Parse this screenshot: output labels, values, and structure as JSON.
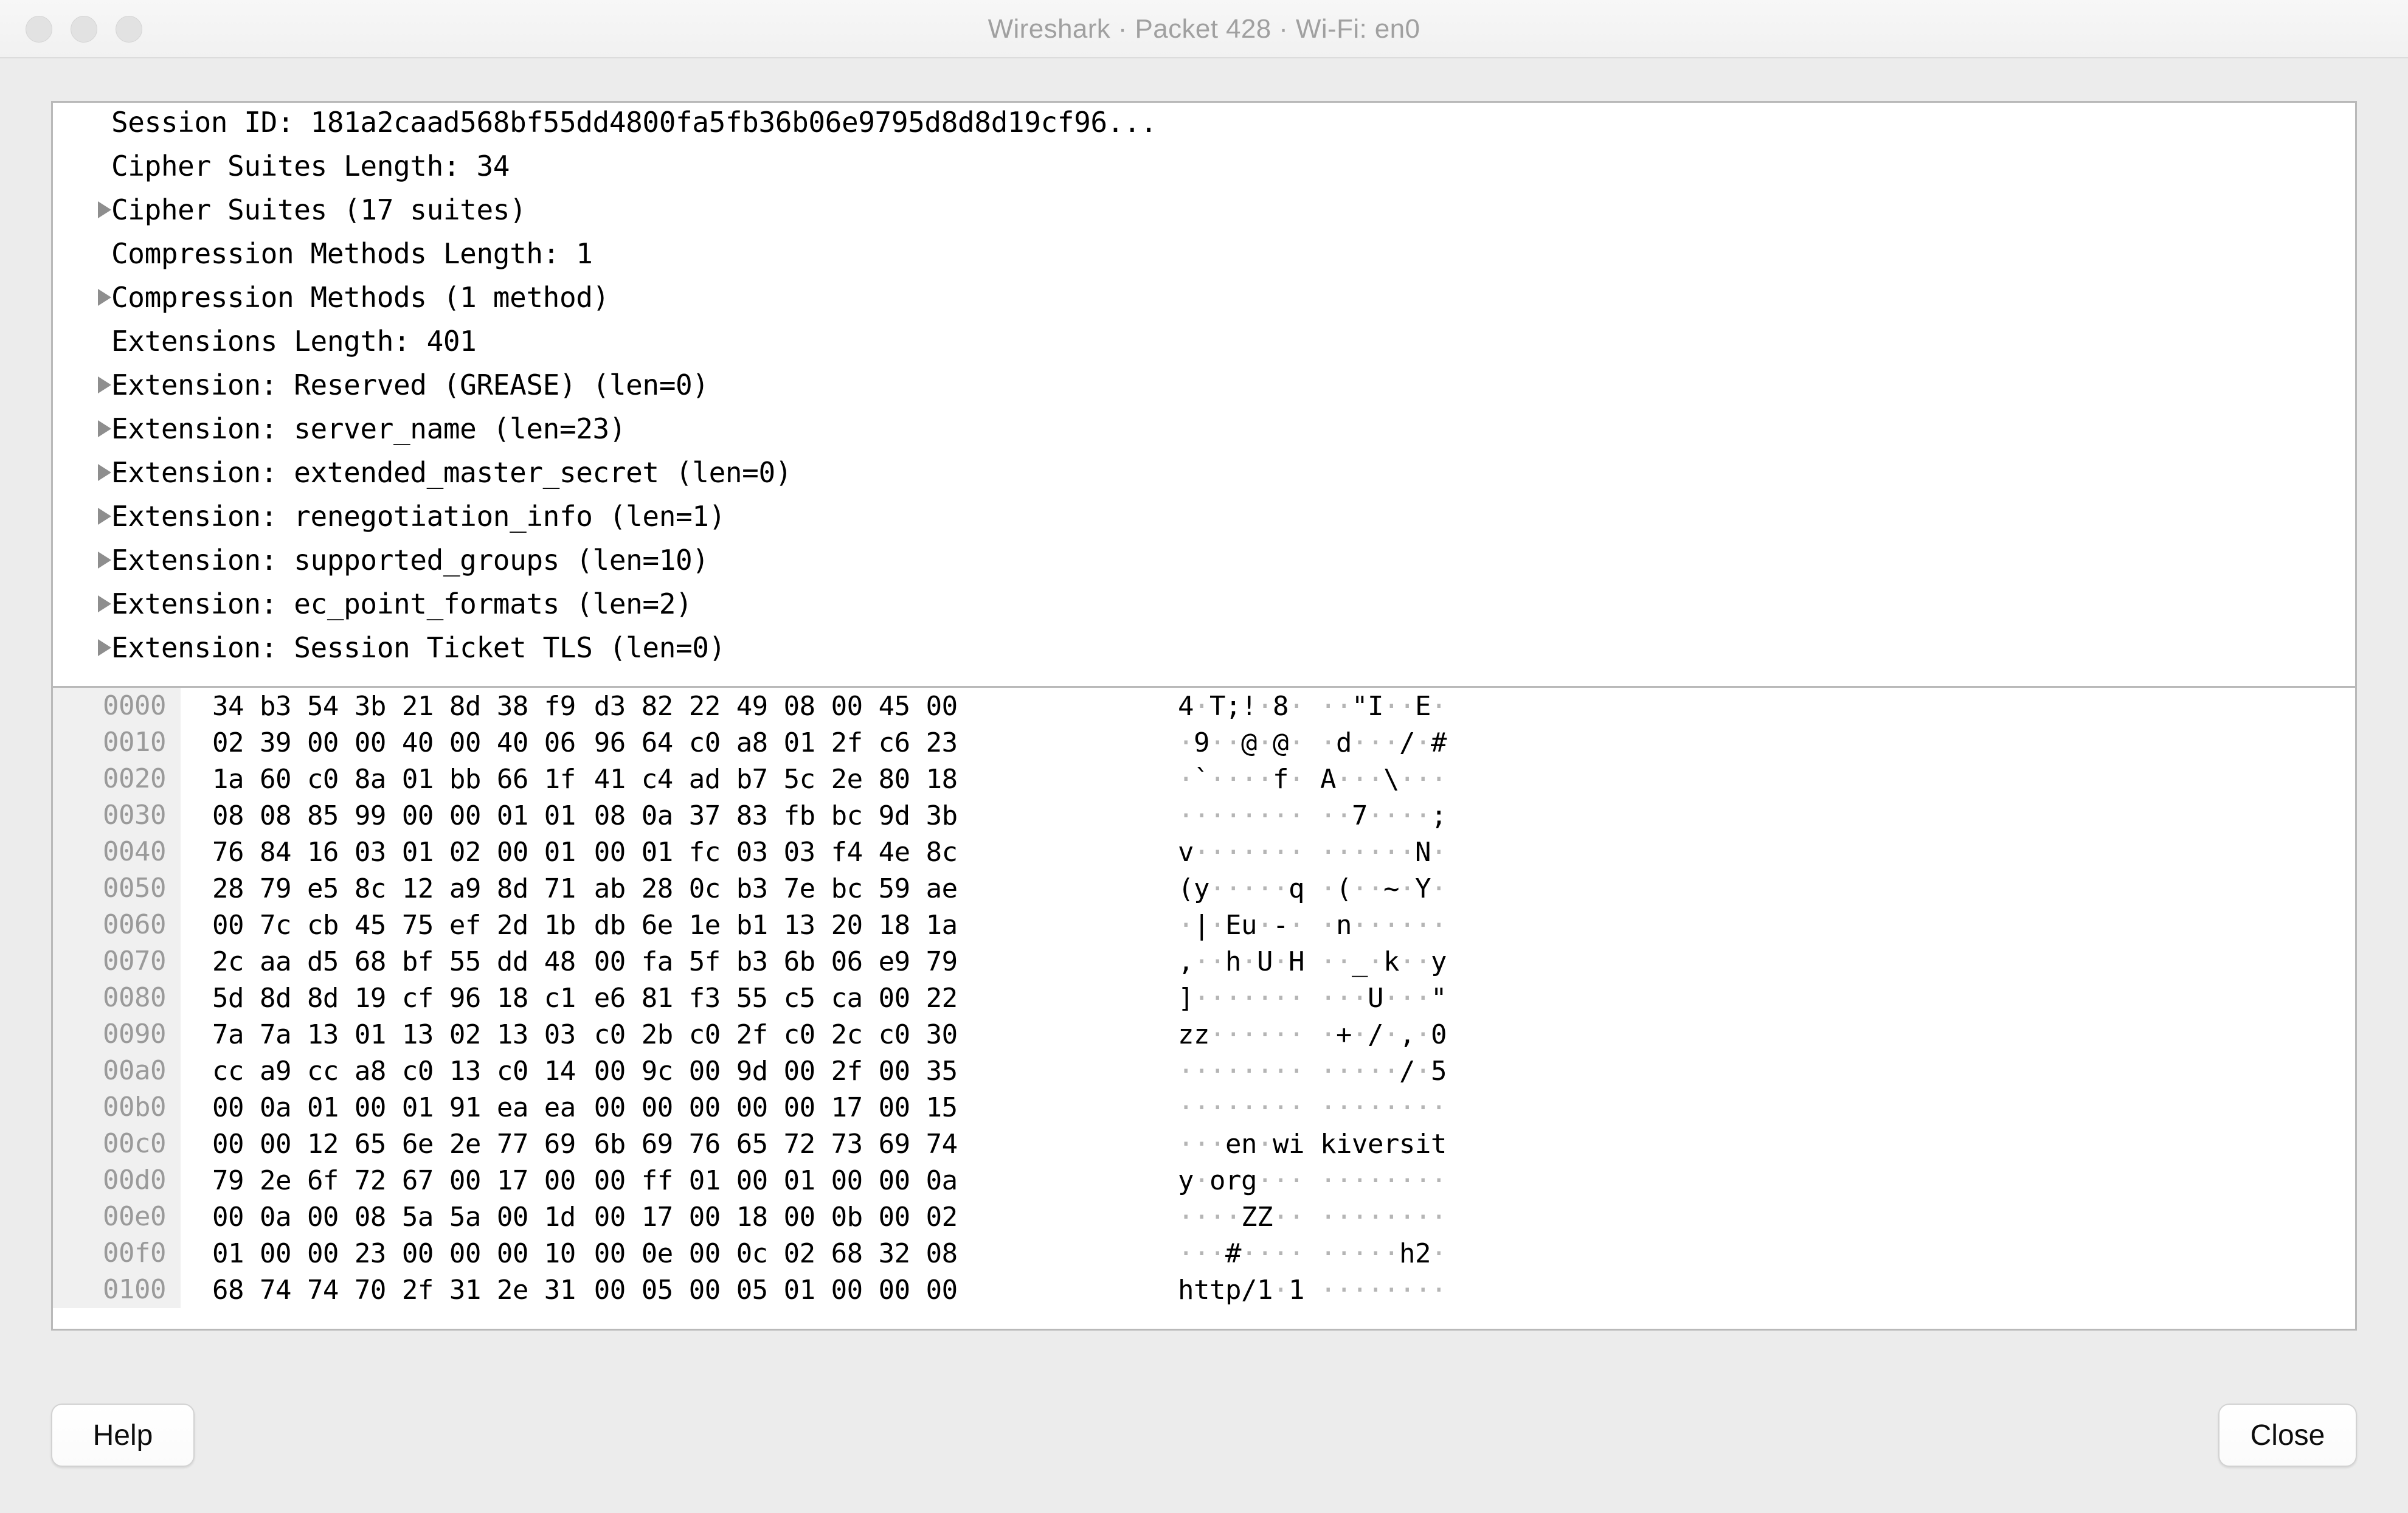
{
  "window": {
    "title": "Wireshark · Packet 428 · Wi-Fi: en0",
    "traffic_lights": [
      "close",
      "minimize",
      "zoom"
    ]
  },
  "packet_detail_tree": {
    "rows": [
      {
        "twisty": false,
        "text": "Session ID: 181a2caad568bf55dd4800fa5fb36b06e9795d8d8d19cf96..."
      },
      {
        "twisty": false,
        "text": "Cipher Suites Length: 34"
      },
      {
        "twisty": true,
        "text": "Cipher Suites (17 suites)"
      },
      {
        "twisty": false,
        "text": "Compression Methods Length: 1"
      },
      {
        "twisty": true,
        "text": "Compression Methods (1 method)"
      },
      {
        "twisty": false,
        "text": "Extensions Length: 401"
      },
      {
        "twisty": true,
        "text": "Extension: Reserved (GREASE) (len=0)"
      },
      {
        "twisty": true,
        "text": "Extension: server_name (len=23)"
      },
      {
        "twisty": true,
        "text": "Extension: extended_master_secret (len=0)"
      },
      {
        "twisty": true,
        "text": "Extension: renegotiation_info (len=1)"
      },
      {
        "twisty": true,
        "text": "Extension: supported_groups (len=10)"
      },
      {
        "twisty": true,
        "text": "Extension: ec_point_formats (len=2)"
      },
      {
        "twisty": true,
        "text": "Extension: Session Ticket TLS (len=0)"
      }
    ]
  },
  "hex_dump": {
    "rows": [
      {
        "offset": "0000",
        "bytes_left": "34 b3 54 3b 21 8d 38 f9",
        "bytes_right": "d3 82 22 49 08 00 45 00",
        "ascii_left": "4.T;!.8.",
        "ascii_right": "..\"I..E."
      },
      {
        "offset": "0010",
        "bytes_left": "02 39 00 00 40 00 40 06",
        "bytes_right": "96 64 c0 a8 01 2f c6 23",
        "ascii_left": ".9..@.@.",
        "ascii_right": ".d.../.#"
      },
      {
        "offset": "0020",
        "bytes_left": "1a 60 c0 8a 01 bb 66 1f",
        "bytes_right": "41 c4 ad b7 5c 2e 80 18",
        "ascii_left": ".`....f.",
        "ascii_right": "A...\\..."
      },
      {
        "offset": "0030",
        "bytes_left": "08 08 85 99 00 00 01 01",
        "bytes_right": "08 0a 37 83 fb bc 9d 3b",
        "ascii_left": "........",
        "ascii_right": "..7....;"
      },
      {
        "offset": "0040",
        "bytes_left": "76 84 16 03 01 02 00 01",
        "bytes_right": "00 01 fc 03 03 f4 4e 8c",
        "ascii_left": "v.......",
        "ascii_right": "......N."
      },
      {
        "offset": "0050",
        "bytes_left": "28 79 e5 8c 12 a9 8d 71",
        "bytes_right": "ab 28 0c b3 7e bc 59 ae",
        "ascii_left": "(y.....q",
        "ascii_right": ".(..~.Y."
      },
      {
        "offset": "0060",
        "bytes_left": "00 7c cb 45 75 ef 2d 1b",
        "bytes_right": "db 6e 1e b1 13 20 18 1a",
        "ascii_left": ".|.Eu.-.",
        "ascii_right": ".n......"
      },
      {
        "offset": "0070",
        "bytes_left": "2c aa d5 68 bf 55 dd 48",
        "bytes_right": "00 fa 5f b3 6b 06 e9 79",
        "ascii_left": ",..h.U.H",
        "ascii_right": ".._.k..y"
      },
      {
        "offset": "0080",
        "bytes_left": "5d 8d 8d 19 cf 96 18 c1",
        "bytes_right": "e6 81 f3 55 c5 ca 00 22",
        "ascii_left": "].......",
        "ascii_right": "...U...\""
      },
      {
        "offset": "0090",
        "bytes_left": "7a 7a 13 01 13 02 13 03",
        "bytes_right": "c0 2b c0 2f c0 2c c0 30",
        "ascii_left": "zz......",
        "ascii_right": ".+./.,.0"
      },
      {
        "offset": "00a0",
        "bytes_left": "cc a9 cc a8 c0 13 c0 14",
        "bytes_right": "00 9c 00 9d 00 2f 00 35",
        "ascii_left": "........",
        "ascii_right": "...../.5"
      },
      {
        "offset": "00b0",
        "bytes_left": "00 0a 01 00 01 91 ea ea",
        "bytes_right": "00 00 00 00 00 17 00 15",
        "ascii_left": "........",
        "ascii_right": "........"
      },
      {
        "offset": "00c0",
        "bytes_left": "00 00 12 65 6e 2e 77 69",
        "bytes_right": "6b 69 76 65 72 73 69 74",
        "ascii_left": "...en.wi",
        "ascii_right": "kiversit"
      },
      {
        "offset": "00d0",
        "bytes_left": "79 2e 6f 72 67 00 17 00",
        "bytes_right": "00 ff 01 00 01 00 00 0a",
        "ascii_left": "y.org...",
        "ascii_right": "........"
      },
      {
        "offset": "00e0",
        "bytes_left": "00 0a 00 08 5a 5a 00 1d",
        "bytes_right": "00 17 00 18 00 0b 00 02",
        "ascii_left": "....ZZ..",
        "ascii_right": "........"
      },
      {
        "offset": "00f0",
        "bytes_left": "01 00 00 23 00 00 00 10",
        "bytes_right": "00 0e 00 0c 02 68 32 08",
        "ascii_left": "...#....",
        "ascii_right": ".....h2."
      },
      {
        "offset": "0100",
        "bytes_left": "68 74 74 70 2f 31 2e 31",
        "bytes_right": "00 05 00 05 01 00 00 00",
        "ascii_left": "http/1.1",
        "ascii_right": "........"
      }
    ]
  },
  "footer": {
    "help_label": "Help",
    "close_label": "Close"
  }
}
